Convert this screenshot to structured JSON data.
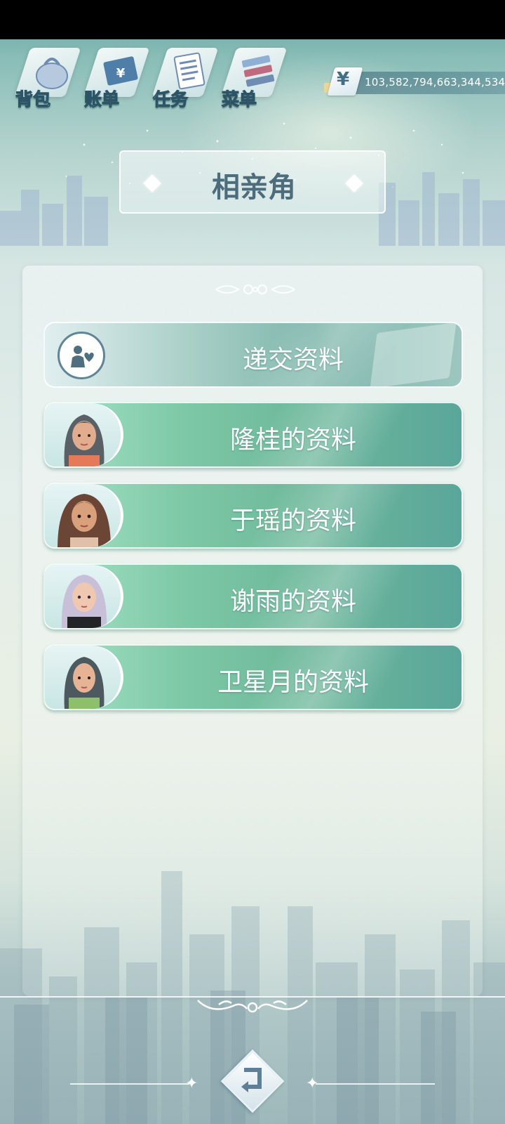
{
  "toolbar": {
    "items": [
      {
        "label": "背包",
        "icon": "bag-icon"
      },
      {
        "label": "账单",
        "icon": "bill-icon"
      },
      {
        "label": "任务",
        "icon": "task-icon"
      },
      {
        "label": "菜单",
        "icon": "menu-icon"
      }
    ]
  },
  "currency": {
    "symbol": "¥",
    "value": "103,582,794,663,344,534"
  },
  "title": "相亲角",
  "submit": {
    "label": "递交资料",
    "icon": "couple-heart-icon"
  },
  "profiles": [
    {
      "label": "隆桂的资料",
      "avatar": "avatar-longgui"
    },
    {
      "label": "于瑶的资料",
      "avatar": "avatar-yuyao"
    },
    {
      "label": "谢雨的资料",
      "avatar": "avatar-xieyu"
    },
    {
      "label": "卫星月的资料",
      "avatar": "avatar-weixingyue"
    }
  ],
  "back": {
    "icon": "back-arrow-icon"
  },
  "colors": {
    "accent": "#4d6d7d",
    "row_green": "#7cc7a5",
    "text_light": "#ffffff"
  }
}
